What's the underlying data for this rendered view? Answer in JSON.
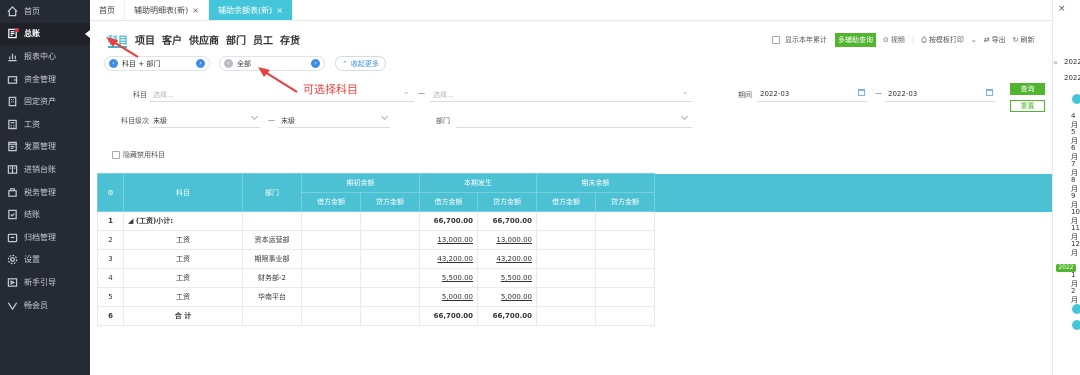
{
  "sidebar": {
    "items": [
      {
        "label": "首页",
        "icon": "home-icon",
        "name": "sidebar-item-home"
      },
      {
        "label": "总账",
        "icon": "ledger-icon",
        "name": "sidebar-item-ledger",
        "active": true
      },
      {
        "label": "报表中心",
        "icon": "chart-icon",
        "name": "sidebar-item-reports"
      },
      {
        "label": "资金管理",
        "icon": "wallet-icon",
        "name": "sidebar-item-funds"
      },
      {
        "label": "固定资产",
        "icon": "building-icon",
        "name": "sidebar-item-assets"
      },
      {
        "label": "工资",
        "icon": "calculator-icon",
        "name": "sidebar-item-salary"
      },
      {
        "label": "发票管理",
        "icon": "invoice-icon",
        "name": "sidebar-item-invoice"
      },
      {
        "label": "进销台账",
        "icon": "book-icon",
        "name": "sidebar-item-inventory"
      },
      {
        "label": "税务管理",
        "icon": "tax-icon",
        "name": "sidebar-item-tax"
      },
      {
        "label": "结账",
        "icon": "checkout-icon",
        "name": "sidebar-item-close"
      },
      {
        "label": "归档管理",
        "icon": "archive-icon",
        "name": "sidebar-item-archive"
      },
      {
        "label": "设置",
        "icon": "gear-icon",
        "name": "sidebar-item-settings"
      },
      {
        "label": "新手引导",
        "icon": "guide-icon",
        "name": "sidebar-item-guide"
      },
      {
        "label": "畅会员",
        "icon": "vip-icon",
        "name": "sidebar-item-vip"
      }
    ]
  },
  "tabs": [
    {
      "label": "首页",
      "closable": false
    },
    {
      "label": "辅助明细表(新)",
      "closable": true
    },
    {
      "label": "辅助余额表(新)",
      "closable": true,
      "active": true
    }
  ],
  "modules": [
    "科目",
    "项目",
    "客户",
    "供应商",
    "部门",
    "员工",
    "存货"
  ],
  "actions": {
    "show_cumulative": "显示本年累计",
    "multi_query": "多辅助查询",
    "video": "视频",
    "print": "按模板打印",
    "export": "导出",
    "refresh": "刷新"
  },
  "selectors": {
    "left": "科目 + 部门",
    "right": "全部",
    "collapse": "收起更多"
  },
  "annotation": "可选择科目",
  "filters": {
    "subject_label": "科目",
    "subject_placeholder": "选择...",
    "subject_placeholder2": "选择...",
    "range_dash": "—",
    "period_label": "期间",
    "period_from": "2022-03",
    "period_to": "2022-03",
    "level_label": "科目级次",
    "level_from": "末级",
    "level_to": "末级",
    "dept_label": "部门",
    "hide_disabled": "隐藏禁用科目",
    "query_button": "查询",
    "reset_button": "重置"
  },
  "table": {
    "headers": {
      "gear": "⚙",
      "subject": "科目",
      "dept": "部门",
      "opening": "期初余额",
      "current": "本期发生",
      "closing": "期末余额",
      "debit": "借方金额",
      "credit": "贷方金额"
    },
    "rows": [
      {
        "idx": "1",
        "subject": "◢ (工资)小计:",
        "dept": "",
        "ob_d": "",
        "ob_c": "",
        "cur_d": "66,700.00",
        "cur_c": "66,700.00",
        "cb_d": "",
        "cb_c": "",
        "bold": true
      },
      {
        "idx": "2",
        "subject": "工资",
        "dept": "资本运营部",
        "ob_d": "",
        "ob_c": "",
        "cur_d": "13,000.00",
        "cur_c": "13,000.00",
        "cb_d": "",
        "cb_c": ""
      },
      {
        "idx": "3",
        "subject": "工资",
        "dept": "期限事业部",
        "ob_d": "",
        "ob_c": "",
        "cur_d": "43,200.00",
        "cur_c": "43,200.00",
        "cb_d": "",
        "cb_c": ""
      },
      {
        "idx": "4",
        "subject": "工资",
        "dept": "财务部-2",
        "ob_d": "",
        "ob_c": "",
        "cur_d": "5,500.00",
        "cur_c": "5,500.00",
        "cb_d": "",
        "cb_c": ""
      },
      {
        "idx": "5",
        "subject": "工资",
        "dept": "华南平台",
        "ob_d": "",
        "ob_c": "",
        "cur_d": "5,000.00",
        "cur_c": "5,000.00",
        "cb_d": "",
        "cb_c": ""
      },
      {
        "idx": "6",
        "subject": "合 计",
        "dept": "",
        "ob_d": "",
        "ob_c": "",
        "cur_d": "66,700.00",
        "cur_c": "66,700.00",
        "cb_d": "",
        "cb_c": "",
        "bold": true
      }
    ]
  },
  "right_panel": {
    "close": "×",
    "toggle": "»",
    "years": [
      "2022",
      "2022"
    ],
    "months": [
      "4月",
      "5月",
      "6月",
      "7月",
      "8月",
      "9月",
      "10月",
      "11月",
      "12月"
    ],
    "badge": "2022",
    "months2": [
      "1月",
      "2月"
    ]
  },
  "colors": {
    "sidebar_bg": "#262a33",
    "accent": "#45c5d9",
    "green": "#52b530",
    "annotation": "#e8403d"
  }
}
